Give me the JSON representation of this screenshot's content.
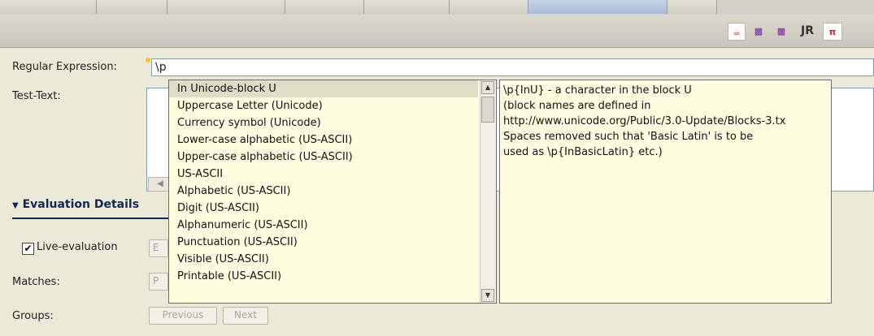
{
  "form": {
    "regex_label": "Regular Expression:",
    "regex_value": "\\p",
    "test_label": "Test-Text:"
  },
  "toolbar": {
    "icons": [
      "java-icon",
      "ppc-icon",
      "ppc-icon",
      "jr-icon",
      "rt-icon"
    ],
    "jr_label": "JR"
  },
  "evaluation": {
    "section_title": "Evaluation Details",
    "live_label": "Live-evaluation",
    "live_checked": true,
    "matches_label": "Matches:",
    "groups_label": "Groups:",
    "previous_label": "Previous",
    "next_label": "Next",
    "eval_btn_fragment": "E",
    "matches_btn_fragment": "P"
  },
  "assist": {
    "items": [
      "In Unicode-block U",
      "Uppercase Letter (Unicode)",
      "Currency symbol (Unicode)",
      "Lower-case alphabetic (US-ASCII)",
      "Upper-case alphabetic (US-ASCII)",
      "US-ASCII",
      "Alphabetic (US-ASCII)",
      "Digit (US-ASCII)",
      "Alphanumeric (US-ASCII)",
      "Punctuation (US-ASCII)",
      "Visible (US-ASCII)",
      "Printable (US-ASCII)"
    ],
    "selected_index": 0,
    "doc_lines": [
      "\\p{InU} - a character in the block U",
      "(block names are defined in",
      "http://www.unicode.org/Public/3.0-Update/Blocks-3.tx",
      "Spaces removed such that 'Basic Latin' is to be",
      "used as \\p{InBasicLatin} etc.)"
    ]
  },
  "colors": {
    "popup_bg": "#fffde0",
    "section_title": "#0b2b56",
    "input_border": "#7f9db9"
  }
}
